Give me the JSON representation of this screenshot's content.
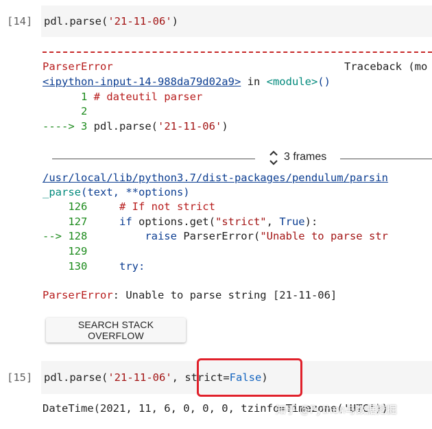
{
  "cell14": {
    "prompt": "[14]",
    "code_prefix": "pdl.parse(",
    "code_string": "'21-11-06'",
    "code_suffix": ")"
  },
  "traceback": {
    "dashes": "---------------------------------------------------------------------",
    "error_name": "ParserError",
    "traceback_label": "Traceback (mo",
    "input_link": "<ipython-input-14-988da79d02a9>",
    "in_word": " in ",
    "module_link": "<module>",
    "module_parens": "()",
    "line1_num": "      1",
    "line1_code": " # dateutil parser",
    "line2_num": "      2",
    "line3_arrow": "----> 3",
    "line3_code_prefix": " pdl.parse(",
    "line3_code_string": "'21-11-06'",
    "line3_code_suffix": ")",
    "frames_label": "3 frames",
    "file_link": "/usr/local/lib/python3.7/dist-packages/pendulum/parsin",
    "func_name": "_parse",
    "func_args": "(text, **options)",
    "l126_num": "    126",
    "l126_code": "     # If not strict",
    "l127_num": "    127",
    "l127_kw": "     if",
    "l127_mid": " options.get(",
    "l127_str": "\"strict\"",
    "l127_comma": ", ",
    "l127_true": "True",
    "l127_end": "):",
    "l128_arrow": "--> 128",
    "l128_kw": "         raise",
    "l128_mid": " ParserError(",
    "l128_str": "\"Unable to parse str",
    "l129_num": "    129",
    "l130_num": "    130",
    "l130_kw": "     try:",
    "final_error_name": "ParserError",
    "final_error_msg": ": Unable to parse string [21-11-06]"
  },
  "so_button": {
    "label": "SEARCH STACK OVERFLOW"
  },
  "cell15": {
    "prompt": "[15]",
    "code_prefix": "pdl.parse(",
    "code_string": "'21-11-06'",
    "code_comma": ", ",
    "kwarg_name": "strict",
    "kwarg_eq": "=",
    "kwarg_value": "False",
    "code_suffix": ")",
    "output": "DateTime(2021, 11, 6, 0, 0, 0, tzinfo=Timezone('UTC'))"
  },
  "watermark": "知乎 @Python与数据挖掘",
  "colors": {
    "highlight_border": "#e0202a",
    "error_red": "#b71c1c",
    "link_blue": "#0b3d91",
    "string_red": "#a31515",
    "arrow_green": "#1b8a1b"
  }
}
